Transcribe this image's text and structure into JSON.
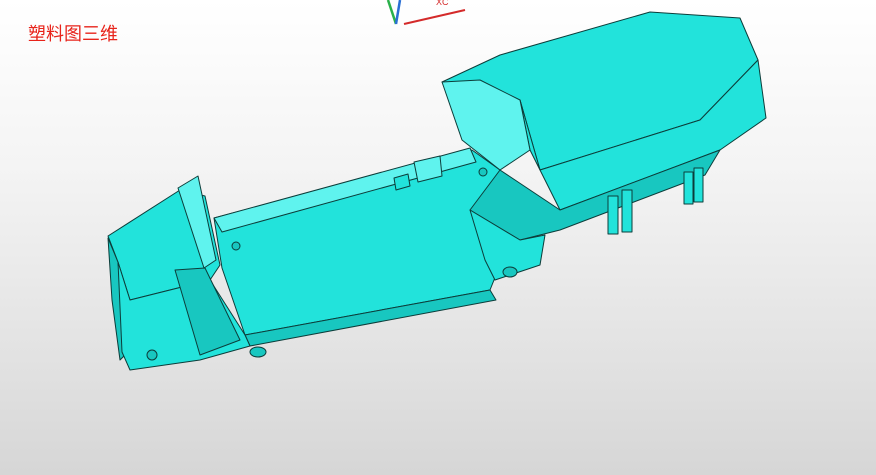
{
  "viewport": {
    "title": "塑料图三维",
    "title_color": "#e8231a",
    "background_top": "#ffffff",
    "background_bottom": "#d6d6d6"
  },
  "triad": {
    "x_label": "XC",
    "x_axis_color": "#d42a2a",
    "y_axis_color": "#2a6fd4",
    "z_axis_color": "#2ab04a"
  },
  "model": {
    "face_color": "#22e3db",
    "shade_color": "#18c7c0",
    "highlight_color": "#5ff3ee",
    "edge_color": "#0c3d3a"
  }
}
